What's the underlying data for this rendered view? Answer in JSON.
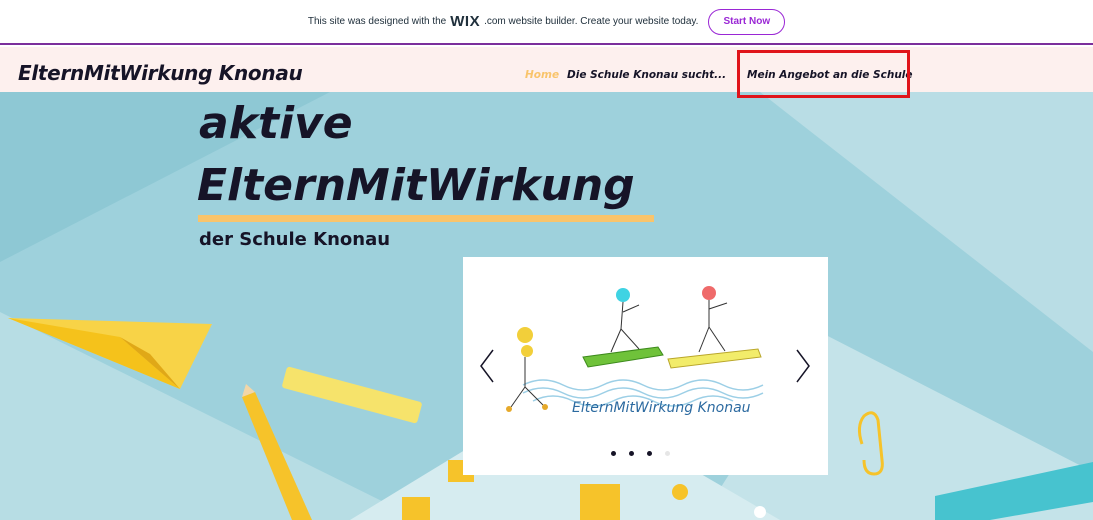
{
  "wix_banner": {
    "text_before": "This site was designed with the",
    "logo": "WIX",
    "text_after": ".com website builder. Create your website today.",
    "cta_label": "Start Now"
  },
  "header": {
    "site_title": "ElternMitWirkung Knonau",
    "nav": [
      {
        "label": "Home",
        "active": true
      },
      {
        "label": "Die Schule Knonau sucht..."
      },
      {
        "label": "Mein Angebot an die Schule",
        "highlighted": true
      }
    ]
  },
  "hero": {
    "line1": "aktive",
    "line2": "ElternMitWirkung",
    "subtitle": "der Schule Knonau"
  },
  "slideshow": {
    "caption": "ElternMitWirkung Knonau",
    "prev_icon": "chevron-left-icon",
    "next_icon": "chevron-right-icon",
    "dots_count": 4,
    "active_dots": 3
  },
  "colors": {
    "accent_yellow": "#f9c46b",
    "header_bg": "#fdf0ee",
    "hero_bg": "#9ed1dc",
    "wix_purple": "#9a27d5",
    "highlight_red": "#e0141a",
    "text_dark": "#161427"
  }
}
